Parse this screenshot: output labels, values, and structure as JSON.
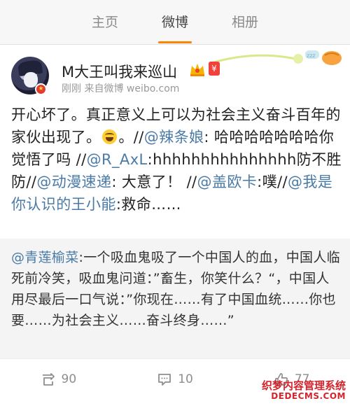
{
  "tabs": [
    {
      "label": "主页",
      "active": false
    },
    {
      "label": "微博",
      "active": true
    },
    {
      "label": "相册",
      "active": false
    }
  ],
  "accent_color": "#ff8200",
  "link_color": "#4a7ba7",
  "post": {
    "username": "M大王叫我来巡山",
    "badge_icon": "vip-crown-icon",
    "red_icon_glyph": "¥",
    "meta": "刚刚  来自微博 weibo.com",
    "body": {
      "p1": "开心坏了。真正意义上可以为社会主义奋斗百年的家伙出现了。",
      "p2": "。//",
      "m1": "@辣条娘",
      "p3": ": 哈哈哈哈哈哈哈你觉悟了吗 //",
      "m2": "@R_AxL",
      "p4": ":hhhhhhhhhhhhhhh防不胜防//",
      "m3": "@动漫速递",
      "p5": ": 大意了！ //",
      "m4": "@盖欧卡",
      "p6": ":噗//",
      "m5": "@我是你认识的王小能",
      "p7": ":救命……"
    }
  },
  "repost": {
    "mention": "@青莲榆菜",
    "text": ":一个吸血鬼吸了一个中国人的血，中国人临死前冷笑，吸血鬼问道：”畜生，你笑什么？“，中国人用尽最后一口气说：”你现在……有了中国血统……你也要……为社会主义……奋斗终身……”"
  },
  "actions": {
    "repost_count": "90",
    "comment_count": "10",
    "like_count": "77"
  },
  "watermark": {
    "line1": "织梦内容管理系统",
    "line2": "DEDECMS.COM"
  }
}
